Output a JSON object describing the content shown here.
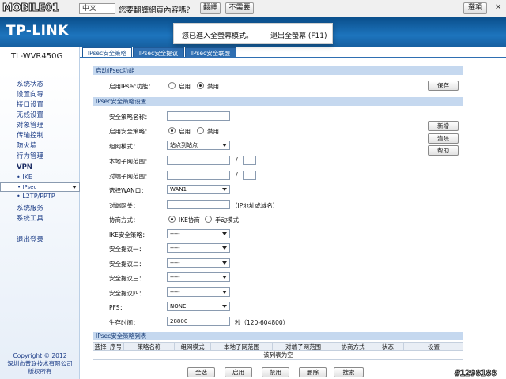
{
  "translate_bar": {
    "logo": "MOBILE01",
    "language": "中文",
    "prompt": "您要翻譯網頁內容嗎？",
    "translate_btn": "翻譯",
    "no_btn": "不需要",
    "options_btn": "選項",
    "close": "✕"
  },
  "fullscreen": {
    "message": "您已進入全螢幕模式。",
    "exit": "退出全螢幕 (F11)"
  },
  "header": {
    "brand": "TP-LINK",
    "model": "TL-WVR450G"
  },
  "tabs": [
    {
      "label": "IPsec安全策略"
    },
    {
      "label": "IPsec安全提议"
    },
    {
      "label": "IPsec安全联盟"
    }
  ],
  "sidebar": {
    "items": [
      "系统状态",
      "设置向导",
      "接口设置",
      "无线设置",
      "对象管理",
      "传输控制",
      "防火墙",
      "行为管理"
    ],
    "vpn": "VPN",
    "vpn_subs": [
      "• IKE",
      "• IPsec",
      "• L2TP/PPTP"
    ],
    "items2": [
      "系统服务",
      "系统工具"
    ],
    "logout": "退出登录",
    "copyright": [
      "Copyright © 2012",
      "深圳市普联技术有限公司",
      "版权所有"
    ]
  },
  "enable_section": {
    "title": "启动IPsec功能",
    "label": "启用IPsec功能：",
    "opt_on": "启用",
    "opt_off": "禁用",
    "save": "保存"
  },
  "policy_section": {
    "title": "IPsec安全策略设置",
    "name_label": "安全策略名称：",
    "enable_label": "启用安全策略：",
    "enable_on": "启用",
    "enable_off": "禁用",
    "mode_label": "组网模式：",
    "mode_value": "站点到站点",
    "local_label": "本地子网范围：",
    "remote_label": "对端子网范围：",
    "wan_label": "选择WAN口：",
    "wan_value": "WAN1",
    "gateway_label": "对端网关：",
    "gateway_hint": "（IP地址或域名）",
    "nego_label": "协商方式：",
    "nego_ike": "IKE协商",
    "nego_manual": "手动模式",
    "ike_policy_label": "IKE安全策略：",
    "p1_label": "安全提议一：",
    "p2_label": "安全提议二：",
    "p3_label": "安全提议三：",
    "p4_label": "安全提议四：",
    "dash": "-----",
    "pfs_label": "PFS：",
    "pfs_value": "NONE",
    "lifetime_label": "生存时间：",
    "lifetime_value": "28800",
    "lifetime_unit": "秒（120-604800）",
    "slash": "/",
    "btn_add": "新增",
    "btn_clear": "清除",
    "btn_help": "帮助"
  },
  "list_section": {
    "title": "IPsec安全策略列表",
    "columns": [
      "选择",
      "序号",
      "策略名称",
      "组网模式",
      "本地子网范围",
      "对端子网范围",
      "协商方式",
      "状态",
      "设置"
    ],
    "empty": "该列表为空",
    "btn_all": "全选",
    "btn_enable": "启用",
    "btn_disable": "禁用",
    "btn_delete": "删除",
    "btn_search": "搜索"
  },
  "watermark": "#1298188"
}
